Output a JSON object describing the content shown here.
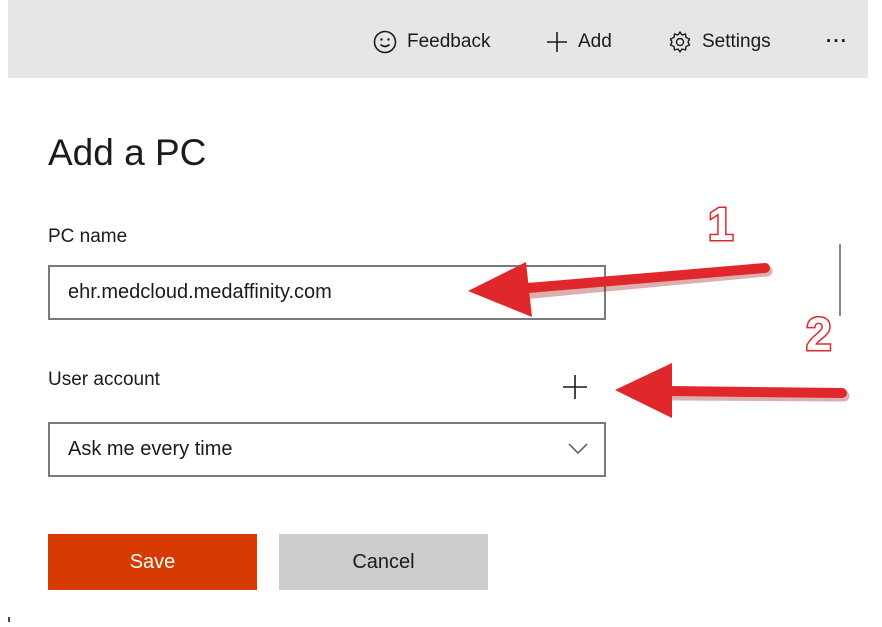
{
  "toolbar": {
    "feedback_label": "Feedback",
    "add_label": "Add",
    "settings_label": "Settings",
    "more_label": "···"
  },
  "page": {
    "title": "Add a PC"
  },
  "pc_name": {
    "label": "PC name",
    "value": "ehr.medcloud.medaffinity.com"
  },
  "user_account": {
    "label": "User account",
    "add_glyph": "+",
    "selected": "Ask me every time"
  },
  "buttons": {
    "save_label": "Save",
    "cancel_label": "Cancel"
  },
  "annotations": {
    "marker_1": "1",
    "marker_2": "2"
  },
  "colors": {
    "toolbar_bg": "#e6e6e6",
    "save_bg": "#d83b01",
    "cancel_bg": "#cccccc",
    "arrow": "#e0272b"
  }
}
